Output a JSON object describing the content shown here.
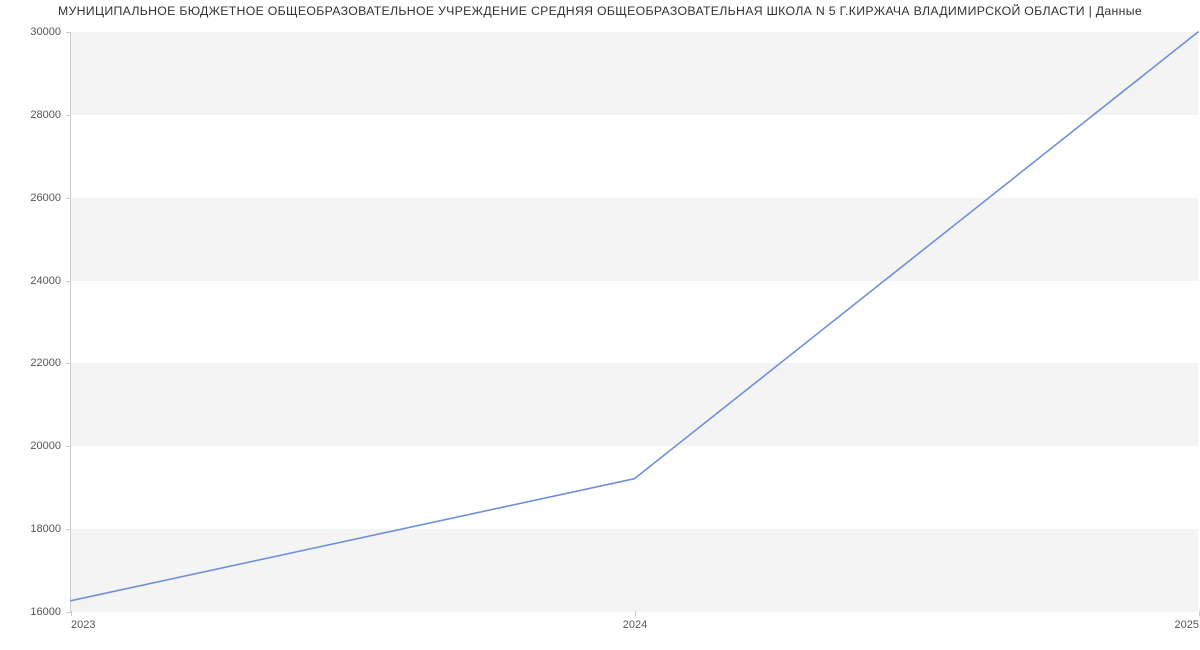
{
  "chart_data": {
    "type": "line",
    "title": "МУНИЦИПАЛЬНОЕ БЮДЖЕТНОЕ ОБЩЕОБРАЗОВАТЕЛЬНОЕ УЧРЕЖДЕНИЕ СРЕДНЯЯ ОБЩЕОБРАЗОВАТЕЛЬНАЯ ШКОЛА N 5 Г.КИРЖАЧА ВЛАДИМИРСКОЙ ОБЛАСТИ | Данные",
    "x": [
      2023,
      2024,
      2025
    ],
    "y": [
      16250,
      19200,
      30000
    ],
    "xlabel": "",
    "ylabel": "",
    "xlim": [
      2023,
      2025
    ],
    "ylim": [
      16000,
      30000
    ],
    "xticks": [
      2023,
      2024,
      2025
    ],
    "yticks": [
      16000,
      18000,
      20000,
      22000,
      24000,
      26000,
      28000,
      30000
    ],
    "bands": [
      [
        16000,
        18000
      ],
      [
        20000,
        22000
      ],
      [
        24000,
        26000
      ],
      [
        28000,
        30000
      ]
    ],
    "colors": {
      "line": "#6f8fd9",
      "band": "#f4f4f4",
      "axis": "#cccccc"
    }
  }
}
